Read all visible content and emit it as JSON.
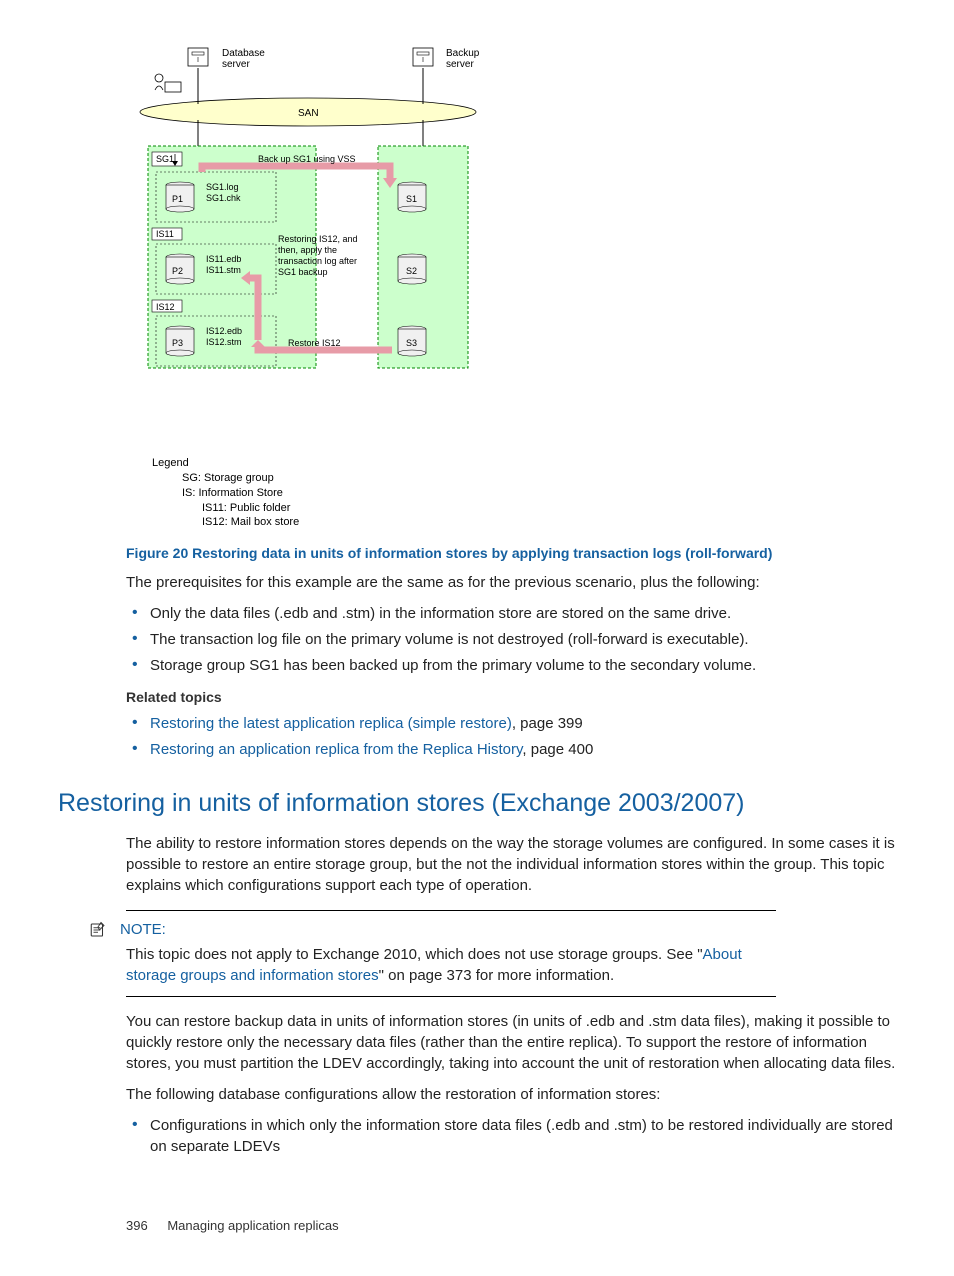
{
  "diagram": {
    "db_server_label": "Database\nserver",
    "backup_server_label": "Backup\nserver",
    "san_label": "SAN",
    "sg1_label": "SG1",
    "backup_action": "Back up SG1 using VSS",
    "p1": "P1",
    "p1_files": "SG1.log\nSG1.chk",
    "is11_label": "IS11",
    "p2": "P2",
    "p2_files": "IS11.edb\nIS11.stm",
    "restore_note": "Restoring IS12, and\nthen, apply the\ntransaction log after\nSG1 backup",
    "is12_label": "IS12",
    "p3": "P3",
    "p3_files": "IS12.edb\nIS12.stm",
    "restore_action": "Restore IS12",
    "s1": "S1",
    "s2": "S2",
    "s3": "S3",
    "legend_title": "Legend",
    "legend_sg": "SG: Storage group",
    "legend_is": "IS: Information Store",
    "legend_is11": "IS11: Public folder",
    "legend_is12": "IS12: Mail box store"
  },
  "figure_caption": "Figure 20 Restoring data in units of information stores by applying transaction logs (roll-forward)",
  "prereq_intro": "The prerequisites for this example are the same as for the previous scenario, plus the following:",
  "bullets": [
    "Only the data files (.edb and .stm) in the information store are stored on the same drive.",
    "The transaction log file on the primary volume is not destroyed (roll-forward is executable).",
    "Storage group SG1 has been backed up from the primary volume to the secondary volume."
  ],
  "related_heading": "Related topics",
  "related": [
    {
      "link": "Restoring the latest application replica (simple restore)",
      "suffix": ", page 399"
    },
    {
      "link": "Restoring an application replica from the Replica History",
      "suffix": ", page 400"
    }
  ],
  "section_heading": "Restoring in units of information stores (Exchange 2003/2007)",
  "section_p1": "The ability to restore information stores depends on the way the storage volumes are configured. In some cases it is possible to restore an entire storage group, but the not the individual information stores within the group. This topic explains which configurations support each type of operation.",
  "note_label": "NOTE:",
  "note_text_a": "This topic does not apply to Exchange 2010, which does not use storage groups. See \"",
  "note_link": "About storage groups and information stores",
  "note_text_b": "\" on page 373 for more information.",
  "section_p2": "You can restore backup data in units of information stores (in units of .edb and .stm data files), making it possible to quickly restore only the necessary data files (rather than the entire replica). To support the restore of information stores, you must partition the LDEV accordingly, taking into account the unit of restoration when allocating data files.",
  "section_p3": "The following database configurations allow the restoration of information stores:",
  "config_bullet": "Configurations in which only the information store data files (.edb and .stm) to be restored individually are stored on separate LDEVs",
  "footer_page": "396",
  "footer_title": "Managing application replicas"
}
